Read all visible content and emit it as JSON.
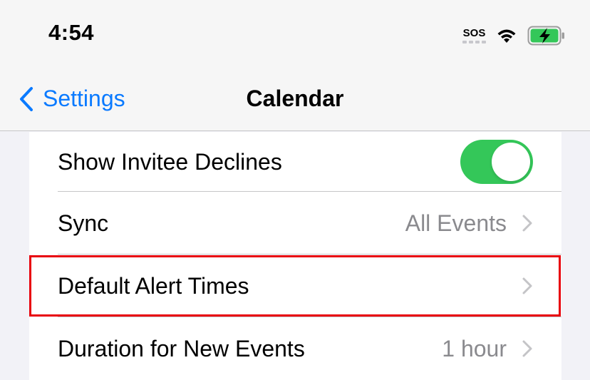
{
  "status_bar": {
    "time": "4:54",
    "sos": "SOS",
    "icons": [
      "cellular-sos-icon",
      "wifi-icon",
      "battery-charging-icon"
    ],
    "battery_color": "#34c759"
  },
  "nav": {
    "back_label": "Settings",
    "title": "Calendar",
    "accent_color": "#0a7aff"
  },
  "rows": [
    {
      "label": "Show Invitee Declines",
      "toggle_on": true
    },
    {
      "label": "Sync",
      "value": "All Events"
    },
    {
      "label": "Default Alert Times",
      "value": ""
    },
    {
      "label": "Duration for New Events",
      "value": "1 hour"
    }
  ],
  "colors": {
    "toggle_on": "#34c759",
    "highlight": "#e8000b"
  }
}
